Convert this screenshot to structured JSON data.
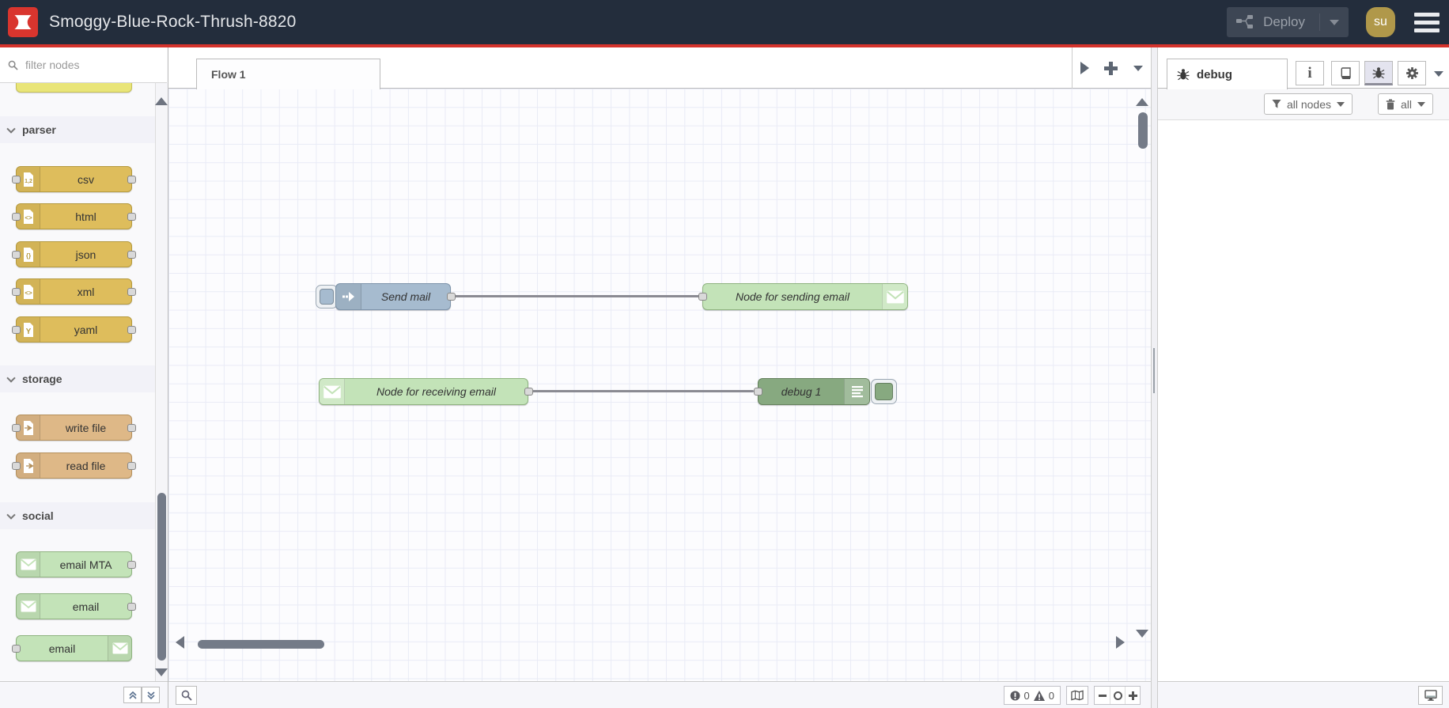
{
  "header": {
    "title": "Smoggy-Blue-Rock-Thrush-8820",
    "deploy_label": "Deploy",
    "user_initials": "su"
  },
  "palette": {
    "search_placeholder": "filter nodes",
    "categories": [
      {
        "label": "parser",
        "nodes": [
          {
            "label": "csv"
          },
          {
            "label": "html"
          },
          {
            "label": "json"
          },
          {
            "label": "xml"
          },
          {
            "label": "yaml"
          }
        ]
      },
      {
        "label": "storage",
        "nodes": [
          {
            "label": "write file"
          },
          {
            "label": "read file"
          }
        ]
      },
      {
        "label": "social",
        "nodes": [
          {
            "label": "email MTA"
          },
          {
            "label": "email"
          },
          {
            "label": "email"
          }
        ]
      }
    ]
  },
  "workspace": {
    "tab_label": "Flow 1"
  },
  "flow": {
    "nodes": [
      {
        "label": "Send mail"
      },
      {
        "label": "Node for sending email"
      },
      {
        "label": "Node for receiving email"
      },
      {
        "label": "debug 1"
      }
    ]
  },
  "debug": {
    "tab_label": "debug",
    "filter_label": "all nodes",
    "clear_label": "all"
  },
  "status": {
    "error_count": "0",
    "warning_count": "0"
  },
  "colors": {
    "accent_red": "#d5332c",
    "header_bg": "#232d3c",
    "inject_node": "#a6bbcf",
    "parser_node": "#debd5c",
    "storage_node": "#deb887",
    "social_node": "#c3e3b8",
    "debug_node": "#87a980",
    "avatar": "#b0984a"
  }
}
